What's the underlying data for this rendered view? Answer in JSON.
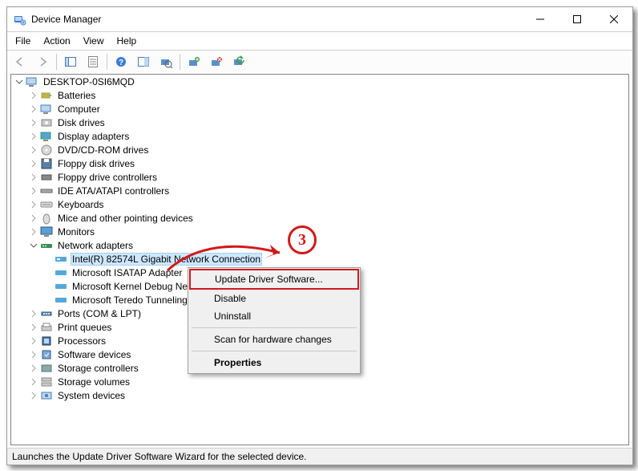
{
  "window": {
    "title": "Device Manager",
    "min_tooltip": "Minimize",
    "max_tooltip": "Maximize",
    "close_tooltip": "Close"
  },
  "menu": {
    "file": "File",
    "action": "Action",
    "view": "View",
    "help": "Help"
  },
  "toolbar": {
    "back": "Back",
    "forward": "Forward",
    "show_hide": "Show/Hide Console Tree",
    "properties": "Properties",
    "help": "Help",
    "action_center": "Scan",
    "update": "Update Driver Software",
    "uninstall": "Uninstall",
    "disable": "Disable",
    "rescan": "Scan for hardware changes"
  },
  "tree": {
    "root": "DESKTOP-0SI6MQD",
    "items": [
      "Batteries",
      "Computer",
      "Disk drives",
      "Display adapters",
      "DVD/CD-ROM drives",
      "Floppy disk drives",
      "Floppy drive controllers",
      "IDE ATA/ATAPI controllers",
      "Keyboards",
      "Mice and other pointing devices",
      "Monitors"
    ],
    "net": {
      "label": "Network adapters",
      "children": [
        "Intel(R) 82574L Gigabit Network Connection",
        "Microsoft ISATAP Adapter",
        "Microsoft Kernel Debug Network Adapter",
        "Microsoft Teredo Tunneling Adapter"
      ]
    },
    "after": [
      "Ports (COM & LPT)",
      "Print queues",
      "Processors",
      "Software devices",
      "Storage controllers",
      "Storage volumes",
      "System devices"
    ]
  },
  "context": {
    "update": "Update Driver Software...",
    "disable": "Disable",
    "uninstall": "Uninstall",
    "scan": "Scan for hardware changes",
    "properties": "Properties"
  },
  "status": "Launches the Update Driver Software Wizard for the selected device.",
  "callout": {
    "step": "3"
  }
}
